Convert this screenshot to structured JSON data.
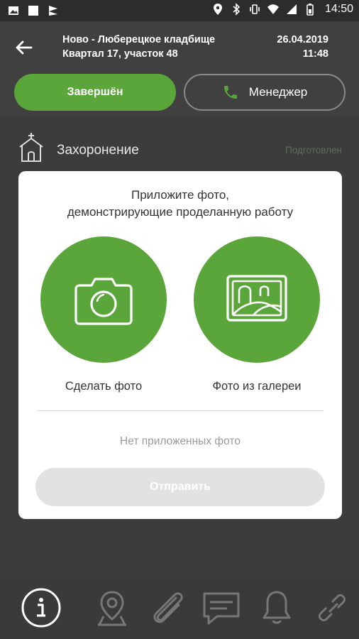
{
  "status_bar": {
    "time": "14:50",
    "icons": [
      "image-icon",
      "square-icon",
      "flag-icon",
      "location-icon",
      "bluetooth-icon",
      "vibrate-icon",
      "wifi-icon",
      "signal-icon",
      "battery-icon"
    ]
  },
  "header": {
    "place_line1": "Ново - Люберецкое кладбище",
    "place_line2": "Квартал 17, участок 48",
    "date": "26.04.2019",
    "time": "11:48",
    "done_button": "Завершён",
    "manager_button": "Менеджер"
  },
  "content": {
    "section_title": "Захоронение",
    "section_status": "Подготовлен"
  },
  "modal": {
    "prompt_line1": "Приложите фото,",
    "prompt_line2": "демонстрирующие проделанную работу",
    "take_photo_label": "Сделать фото",
    "gallery_label": "Фото из галереи",
    "empty_text": "Нет приложенных фото",
    "send_button": "Отправить"
  },
  "bottom_nav": [
    "info-icon",
    "map-pin-icon",
    "paperclip-icon",
    "chat-icon",
    "bell-icon",
    "link-icon"
  ],
  "colors": {
    "accent_green": "#5aa63a",
    "background_dark": "#3a3a3a",
    "send_disabled": "#e2e2e2"
  }
}
